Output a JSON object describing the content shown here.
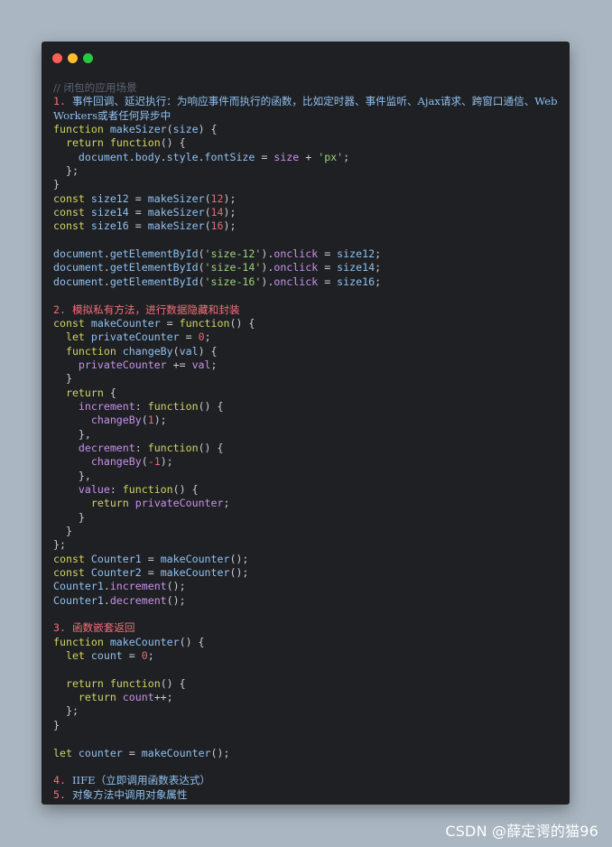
{
  "window": {
    "traffic_lights": [
      {
        "name": "close",
        "color": "#ff5f56"
      },
      {
        "name": "minimize",
        "color": "#ffbd2e"
      },
      {
        "name": "maximize",
        "color": "#27c93f"
      }
    ]
  },
  "code_lines": [
    [
      {
        "t": "// 闭包的应用场景",
        "c": "c"
      }
    ],
    [
      {
        "t": "1. ",
        "c": "n"
      },
      {
        "t": "事件回调、延迟执行：为响应事件而执行的函数，比如定时器、事件监听、Ajax请求、跨窗口通信、Web",
        "c": "v"
      }
    ],
    [
      {
        "t": "Workers或者任何异步中",
        "c": "v"
      }
    ],
    [
      {
        "t": "function ",
        "c": "k"
      },
      {
        "t": "makeSizer",
        "c": "v"
      },
      {
        "t": "(",
        "c": ""
      },
      {
        "t": "size",
        "c": "v"
      },
      {
        "t": ") {",
        "c": ""
      }
    ],
    [
      {
        "t": "  ",
        "c": ""
      },
      {
        "t": "return ",
        "c": "k"
      },
      {
        "t": "function",
        "c": "k"
      },
      {
        "t": "() {",
        "c": ""
      }
    ],
    [
      {
        "t": "    ",
        "c": ""
      },
      {
        "t": "document",
        "c": "v"
      },
      {
        "t": ".",
        "c": ""
      },
      {
        "t": "body",
        "c": "v"
      },
      {
        "t": ".",
        "c": ""
      },
      {
        "t": "style",
        "c": "v"
      },
      {
        "t": ".",
        "c": ""
      },
      {
        "t": "fontSize",
        "c": "v"
      },
      {
        "t": " = ",
        "c": ""
      },
      {
        "t": "size",
        "c": "p"
      },
      {
        "t": " + ",
        "c": ""
      },
      {
        "t": "'px'",
        "c": "s"
      },
      {
        "t": ";",
        "c": ""
      }
    ],
    [
      {
        "t": "  };",
        "c": ""
      }
    ],
    [
      {
        "t": "}",
        "c": ""
      }
    ],
    [
      {
        "t": "const ",
        "c": "k"
      },
      {
        "t": "size12",
        "c": "v"
      },
      {
        "t": " = ",
        "c": ""
      },
      {
        "t": "makeSizer",
        "c": "v"
      },
      {
        "t": "(",
        "c": ""
      },
      {
        "t": "12",
        "c": "num"
      },
      {
        "t": ");",
        "c": ""
      }
    ],
    [
      {
        "t": "const ",
        "c": "k"
      },
      {
        "t": "size14",
        "c": "v"
      },
      {
        "t": " = ",
        "c": ""
      },
      {
        "t": "makeSizer",
        "c": "v"
      },
      {
        "t": "(",
        "c": ""
      },
      {
        "t": "14",
        "c": "num"
      },
      {
        "t": ");",
        "c": ""
      }
    ],
    [
      {
        "t": "const ",
        "c": "k"
      },
      {
        "t": "size16",
        "c": "v"
      },
      {
        "t": " = ",
        "c": ""
      },
      {
        "t": "makeSizer",
        "c": "v"
      },
      {
        "t": "(",
        "c": ""
      },
      {
        "t": "16",
        "c": "num"
      },
      {
        "t": ");",
        "c": ""
      }
    ],
    [],
    [
      {
        "t": "document",
        "c": "v"
      },
      {
        "t": ".",
        "c": ""
      },
      {
        "t": "getElementById",
        "c": "v"
      },
      {
        "t": "(",
        "c": ""
      },
      {
        "t": "'size-12'",
        "c": "s"
      },
      {
        "t": ").",
        "c": ""
      },
      {
        "t": "onclick",
        "c": "p"
      },
      {
        "t": " = ",
        "c": ""
      },
      {
        "t": "size12",
        "c": "v"
      },
      {
        "t": ";",
        "c": ""
      }
    ],
    [
      {
        "t": "document",
        "c": "v"
      },
      {
        "t": ".",
        "c": ""
      },
      {
        "t": "getElementById",
        "c": "v"
      },
      {
        "t": "(",
        "c": ""
      },
      {
        "t": "'size-14'",
        "c": "s"
      },
      {
        "t": ").",
        "c": ""
      },
      {
        "t": "onclick",
        "c": "p"
      },
      {
        "t": " = ",
        "c": ""
      },
      {
        "t": "size14",
        "c": "v"
      },
      {
        "t": ";",
        "c": ""
      }
    ],
    [
      {
        "t": "document",
        "c": "v"
      },
      {
        "t": ".",
        "c": ""
      },
      {
        "t": "getElementById",
        "c": "v"
      },
      {
        "t": "(",
        "c": ""
      },
      {
        "t": "'size-16'",
        "c": "s"
      },
      {
        "t": ").",
        "c": ""
      },
      {
        "t": "onclick",
        "c": "p"
      },
      {
        "t": " = ",
        "c": ""
      },
      {
        "t": "size16",
        "c": "v"
      },
      {
        "t": ";",
        "c": ""
      }
    ],
    [],
    [
      {
        "t": "2. ",
        "c": "n"
      },
      {
        "t": "模拟私有方法，进行数据隐藏和封装",
        "c": "n"
      }
    ],
    [
      {
        "t": "const ",
        "c": "k"
      },
      {
        "t": "makeCounter",
        "c": "v"
      },
      {
        "t": " = ",
        "c": ""
      },
      {
        "t": "function",
        "c": "k"
      },
      {
        "t": "() {",
        "c": ""
      }
    ],
    [
      {
        "t": "  ",
        "c": ""
      },
      {
        "t": "let ",
        "c": "k"
      },
      {
        "t": "privateCounter",
        "c": "v"
      },
      {
        "t": " = ",
        "c": ""
      },
      {
        "t": "0",
        "c": "num"
      },
      {
        "t": ";",
        "c": ""
      }
    ],
    [
      {
        "t": "  ",
        "c": ""
      },
      {
        "t": "function ",
        "c": "k"
      },
      {
        "t": "changeBy",
        "c": "v"
      },
      {
        "t": "(",
        "c": ""
      },
      {
        "t": "val",
        "c": "v"
      },
      {
        "t": ") {",
        "c": ""
      }
    ],
    [
      {
        "t": "    ",
        "c": ""
      },
      {
        "t": "privateCounter",
        "c": "p"
      },
      {
        "t": " += ",
        "c": ""
      },
      {
        "t": "val",
        "c": "p"
      },
      {
        "t": ";",
        "c": ""
      }
    ],
    [
      {
        "t": "  }",
        "c": ""
      }
    ],
    [
      {
        "t": "  ",
        "c": ""
      },
      {
        "t": "return ",
        "c": "k"
      },
      {
        "t": "{",
        "c": ""
      }
    ],
    [
      {
        "t": "    ",
        "c": ""
      },
      {
        "t": "increment",
        "c": "p"
      },
      {
        "t": ": ",
        "c": ""
      },
      {
        "t": "function",
        "c": "k"
      },
      {
        "t": "() {",
        "c": ""
      }
    ],
    [
      {
        "t": "      ",
        "c": ""
      },
      {
        "t": "changeBy",
        "c": "p"
      },
      {
        "t": "(",
        "c": ""
      },
      {
        "t": "1",
        "c": "num"
      },
      {
        "t": ");",
        "c": ""
      }
    ],
    [
      {
        "t": "    },",
        "c": ""
      }
    ],
    [
      {
        "t": "    ",
        "c": ""
      },
      {
        "t": "decrement",
        "c": "p"
      },
      {
        "t": ": ",
        "c": ""
      },
      {
        "t": "function",
        "c": "k"
      },
      {
        "t": "() {",
        "c": ""
      }
    ],
    [
      {
        "t": "      ",
        "c": ""
      },
      {
        "t": "changeBy",
        "c": "p"
      },
      {
        "t": "(",
        "c": ""
      },
      {
        "t": "-1",
        "c": "num"
      },
      {
        "t": ");",
        "c": ""
      }
    ],
    [
      {
        "t": "    },",
        "c": ""
      }
    ],
    [
      {
        "t": "    ",
        "c": ""
      },
      {
        "t": "value",
        "c": "p"
      },
      {
        "t": ": ",
        "c": ""
      },
      {
        "t": "function",
        "c": "k"
      },
      {
        "t": "() {",
        "c": ""
      }
    ],
    [
      {
        "t": "      ",
        "c": ""
      },
      {
        "t": "return ",
        "c": "k"
      },
      {
        "t": "privateCounter",
        "c": "p"
      },
      {
        "t": ";",
        "c": ""
      }
    ],
    [
      {
        "t": "    }",
        "c": ""
      }
    ],
    [
      {
        "t": "  }",
        "c": ""
      }
    ],
    [
      {
        "t": "};",
        "c": ""
      }
    ],
    [
      {
        "t": "const ",
        "c": "k"
      },
      {
        "t": "Counter1",
        "c": "v"
      },
      {
        "t": " = ",
        "c": ""
      },
      {
        "t": "makeCounter",
        "c": "v"
      },
      {
        "t": "();",
        "c": ""
      }
    ],
    [
      {
        "t": "const ",
        "c": "k"
      },
      {
        "t": "Counter2",
        "c": "v"
      },
      {
        "t": " = ",
        "c": ""
      },
      {
        "t": "makeCounter",
        "c": "v"
      },
      {
        "t": "();",
        "c": ""
      }
    ],
    [
      {
        "t": "Counter1",
        "c": "v"
      },
      {
        "t": ".",
        "c": ""
      },
      {
        "t": "increment",
        "c": "p"
      },
      {
        "t": "();",
        "c": ""
      }
    ],
    [
      {
        "t": "Counter1",
        "c": "v"
      },
      {
        "t": ".",
        "c": ""
      },
      {
        "t": "decrement",
        "c": "p"
      },
      {
        "t": "();",
        "c": ""
      }
    ],
    [],
    [
      {
        "t": "3. ",
        "c": "n"
      },
      {
        "t": "函数嵌套返回",
        "c": "n"
      }
    ],
    [
      {
        "t": "function ",
        "c": "k"
      },
      {
        "t": "makeCounter",
        "c": "v"
      },
      {
        "t": "() {",
        "c": ""
      }
    ],
    [
      {
        "t": "  ",
        "c": ""
      },
      {
        "t": "let ",
        "c": "k"
      },
      {
        "t": "count",
        "c": "v"
      },
      {
        "t": " = ",
        "c": ""
      },
      {
        "t": "0",
        "c": "num"
      },
      {
        "t": ";",
        "c": ""
      }
    ],
    [],
    [
      {
        "t": "  ",
        "c": ""
      },
      {
        "t": "return ",
        "c": "k"
      },
      {
        "t": "function",
        "c": "k"
      },
      {
        "t": "() {",
        "c": ""
      }
    ],
    [
      {
        "t": "    ",
        "c": ""
      },
      {
        "t": "return ",
        "c": "k"
      },
      {
        "t": "count",
        "c": "p"
      },
      {
        "t": "++;",
        "c": ""
      }
    ],
    [
      {
        "t": "  };",
        "c": ""
      }
    ],
    [
      {
        "t": "}",
        "c": ""
      }
    ],
    [],
    [
      {
        "t": "let ",
        "c": "k"
      },
      {
        "t": "counter",
        "c": "v"
      },
      {
        "t": " = ",
        "c": ""
      },
      {
        "t": "makeCounter",
        "c": "v"
      },
      {
        "t": "();",
        "c": ""
      }
    ],
    [],
    [
      {
        "t": "4. ",
        "c": "n"
      },
      {
        "t": "IIFE（立即调用函数表达式）",
        "c": "v"
      }
    ],
    [
      {
        "t": "5. ",
        "c": "n"
      },
      {
        "t": "对象方法中调用对象属性",
        "c": "v"
      }
    ]
  ],
  "watermark": "CSDN @薛定谔的猫96"
}
